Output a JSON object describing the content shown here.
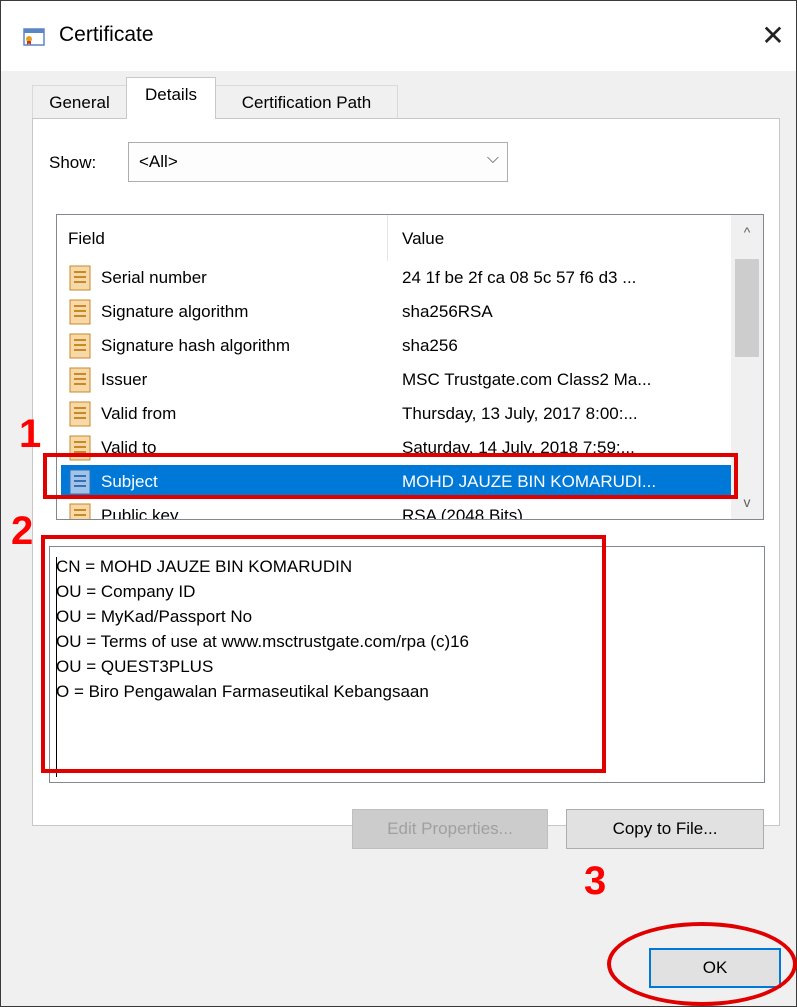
{
  "window": {
    "title": "Certificate",
    "close_glyph": "✕"
  },
  "tabs": [
    {
      "label": "General",
      "active": false
    },
    {
      "label": "Details",
      "active": true
    },
    {
      "label": "Certification Path",
      "active": false
    }
  ],
  "show": {
    "label": "Show:",
    "value": "<All>",
    "chevron": "⌵"
  },
  "list": {
    "headers": {
      "field": "Field",
      "value": "Value"
    },
    "rows": [
      {
        "field": "Serial number",
        "value": "24 1f be 2f ca 08 5c 57 f6 d3 ..."
      },
      {
        "field": "Signature algorithm",
        "value": "sha256RSA"
      },
      {
        "field": "Signature hash algorithm",
        "value": "sha256"
      },
      {
        "field": "Issuer",
        "value": "MSC Trustgate.com Class2 Ma..."
      },
      {
        "field": "Valid from",
        "value": "Thursday, 13 July, 2017 8:00:..."
      },
      {
        "field": "Valid to",
        "value": "Saturday, 14 July, 2018 7:59:..."
      },
      {
        "field": "Subject",
        "value": "MOHD JAUZE BIN KOMARUDI...",
        "selected": true
      },
      {
        "field": "Public key",
        "value": "RSA (2048 Bits)"
      }
    ],
    "scroll_up_glyph": "^",
    "scroll_down_glyph": "v"
  },
  "details": {
    "lines": [
      "CN = MOHD JAUZE BIN KOMARUDIN",
      "OU = Company ID",
      "OU = MyKad/Passport No",
      "OU = Terms of use at www.msctrustgate.com/rpa (c)16",
      "OU = QUEST3PLUS",
      "O = Biro Pengawalan Farmaseutikal Kebangsaan"
    ]
  },
  "buttons": {
    "edit_properties": "Edit Properties...",
    "copy_to_file": "Copy to File...",
    "ok": "OK"
  },
  "annotations": {
    "one": "1",
    "two": "2",
    "three": "3",
    "color": "#e00000"
  },
  "colors": {
    "selection": "#0078d7",
    "window_bg": "#f0f0f0"
  }
}
